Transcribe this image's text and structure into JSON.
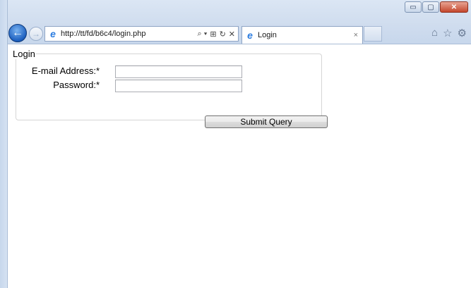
{
  "browser": {
    "address": "http://tt/fd/b6c4/login.php",
    "tab_title": "Login",
    "tab_close": "×",
    "window_controls": {
      "minimize": "▭",
      "maximize": "▢",
      "close": "✕"
    },
    "back_glyph": "←",
    "forward_glyph": "→",
    "address_tools": [
      "⌕ ▾",
      "⊞",
      "↻",
      "✕"
    ],
    "right_icons": [
      "⌂",
      "☆",
      "⚙"
    ]
  },
  "form": {
    "legend": "Login",
    "email_label": "E-mail Address:*",
    "email_value": "",
    "password_label": "Password:*",
    "password_value": "",
    "submit_label": "Submit Query"
  },
  "colors": {
    "accent": "#1c5fbf",
    "chrome": "#cfdcee",
    "close_button": "#c4472d"
  }
}
